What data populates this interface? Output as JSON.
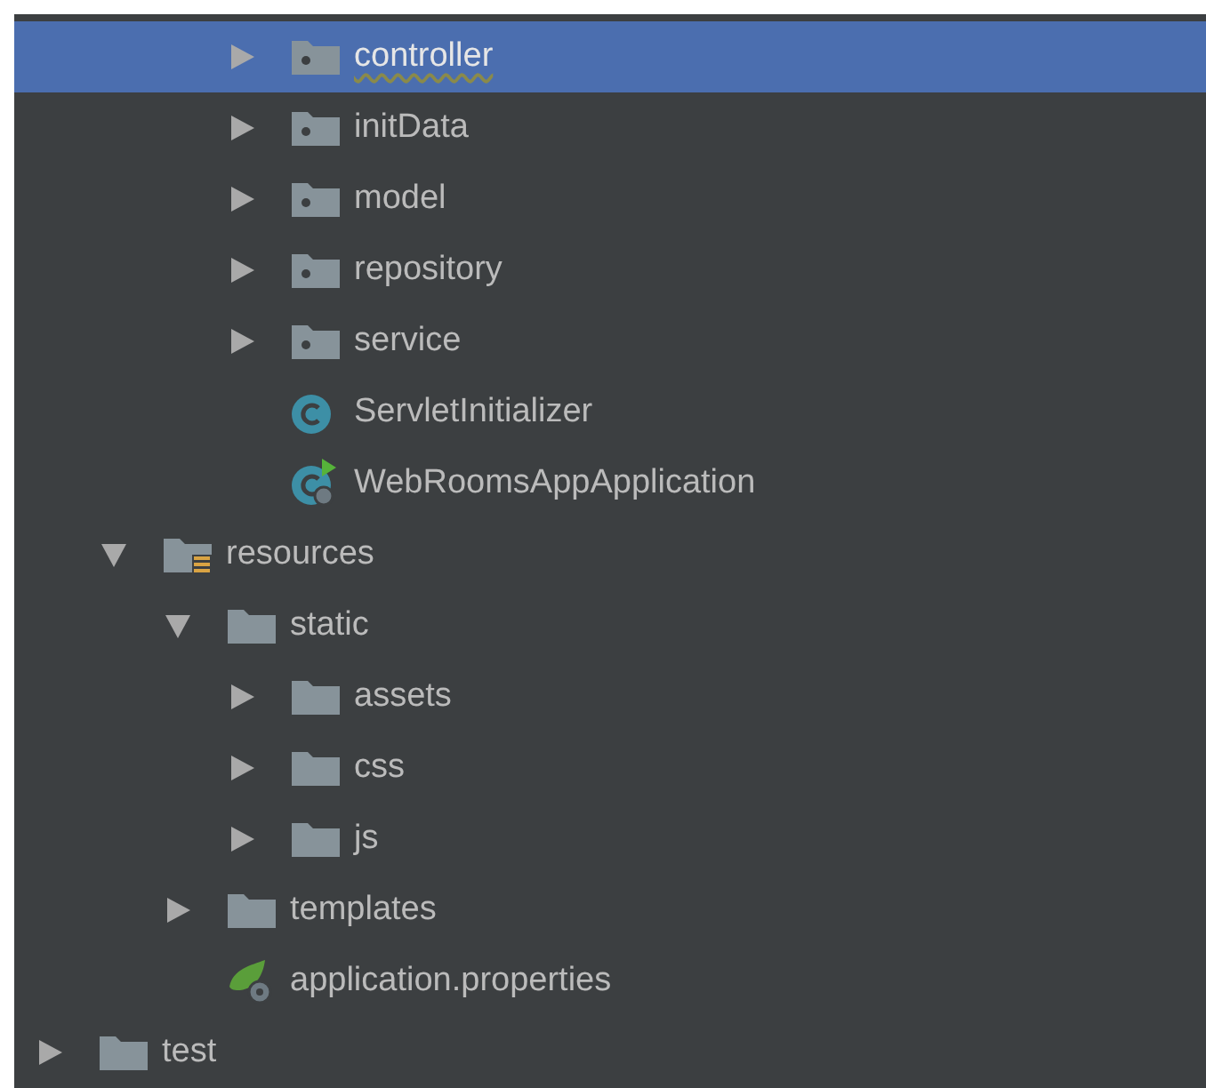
{
  "tree": [
    {
      "children": [
        {
          "children": [
            {
              "children": [
                {
                  "label": "controller",
                  "kind": "package",
                  "expanded": false,
                  "selected": true,
                  "typo": true
                },
                {
                  "label": "initData",
                  "kind": "package",
                  "expanded": false,
                  "selected": false,
                  "typo": false
                },
                {
                  "label": "model",
                  "kind": "package",
                  "expanded": false,
                  "selected": false,
                  "typo": false
                },
                {
                  "label": "repository",
                  "kind": "package",
                  "expanded": false,
                  "selected": false,
                  "typo": false
                },
                {
                  "label": "service",
                  "kind": "package",
                  "expanded": false,
                  "selected": false,
                  "typo": false
                },
                {
                  "label": "ServletInitializer",
                  "kind": "class",
                  "selected": false,
                  "typo": false
                },
                {
                  "label": "WebRoomsAppApplication",
                  "kind": "boot-class",
                  "selected": false,
                  "typo": false
                }
              ]
            }
          ]
        },
        {
          "label": "resources",
          "kind": "resources-folder",
          "expanded": true,
          "selected": false,
          "typo": false,
          "children": [
            {
              "label": "static",
              "kind": "folder",
              "expanded": true,
              "selected": false,
              "typo": false,
              "children": [
                {
                  "label": "assets",
                  "kind": "folder",
                  "expanded": false,
                  "selected": false,
                  "typo": false
                },
                {
                  "label": "css",
                  "kind": "folder",
                  "expanded": false,
                  "selected": false,
                  "typo": false
                },
                {
                  "label": "js",
                  "kind": "folder",
                  "expanded": false,
                  "selected": false,
                  "typo": false
                }
              ]
            },
            {
              "label": "templates",
              "kind": "folder",
              "expanded": false,
              "selected": false,
              "typo": false
            },
            {
              "label": "application.properties",
              "kind": "properties",
              "selected": false,
              "typo": false
            }
          ]
        }
      ]
    },
    {
      "label": "test",
      "kind": "folder",
      "expanded": false,
      "selected": false,
      "typo": false
    }
  ]
}
